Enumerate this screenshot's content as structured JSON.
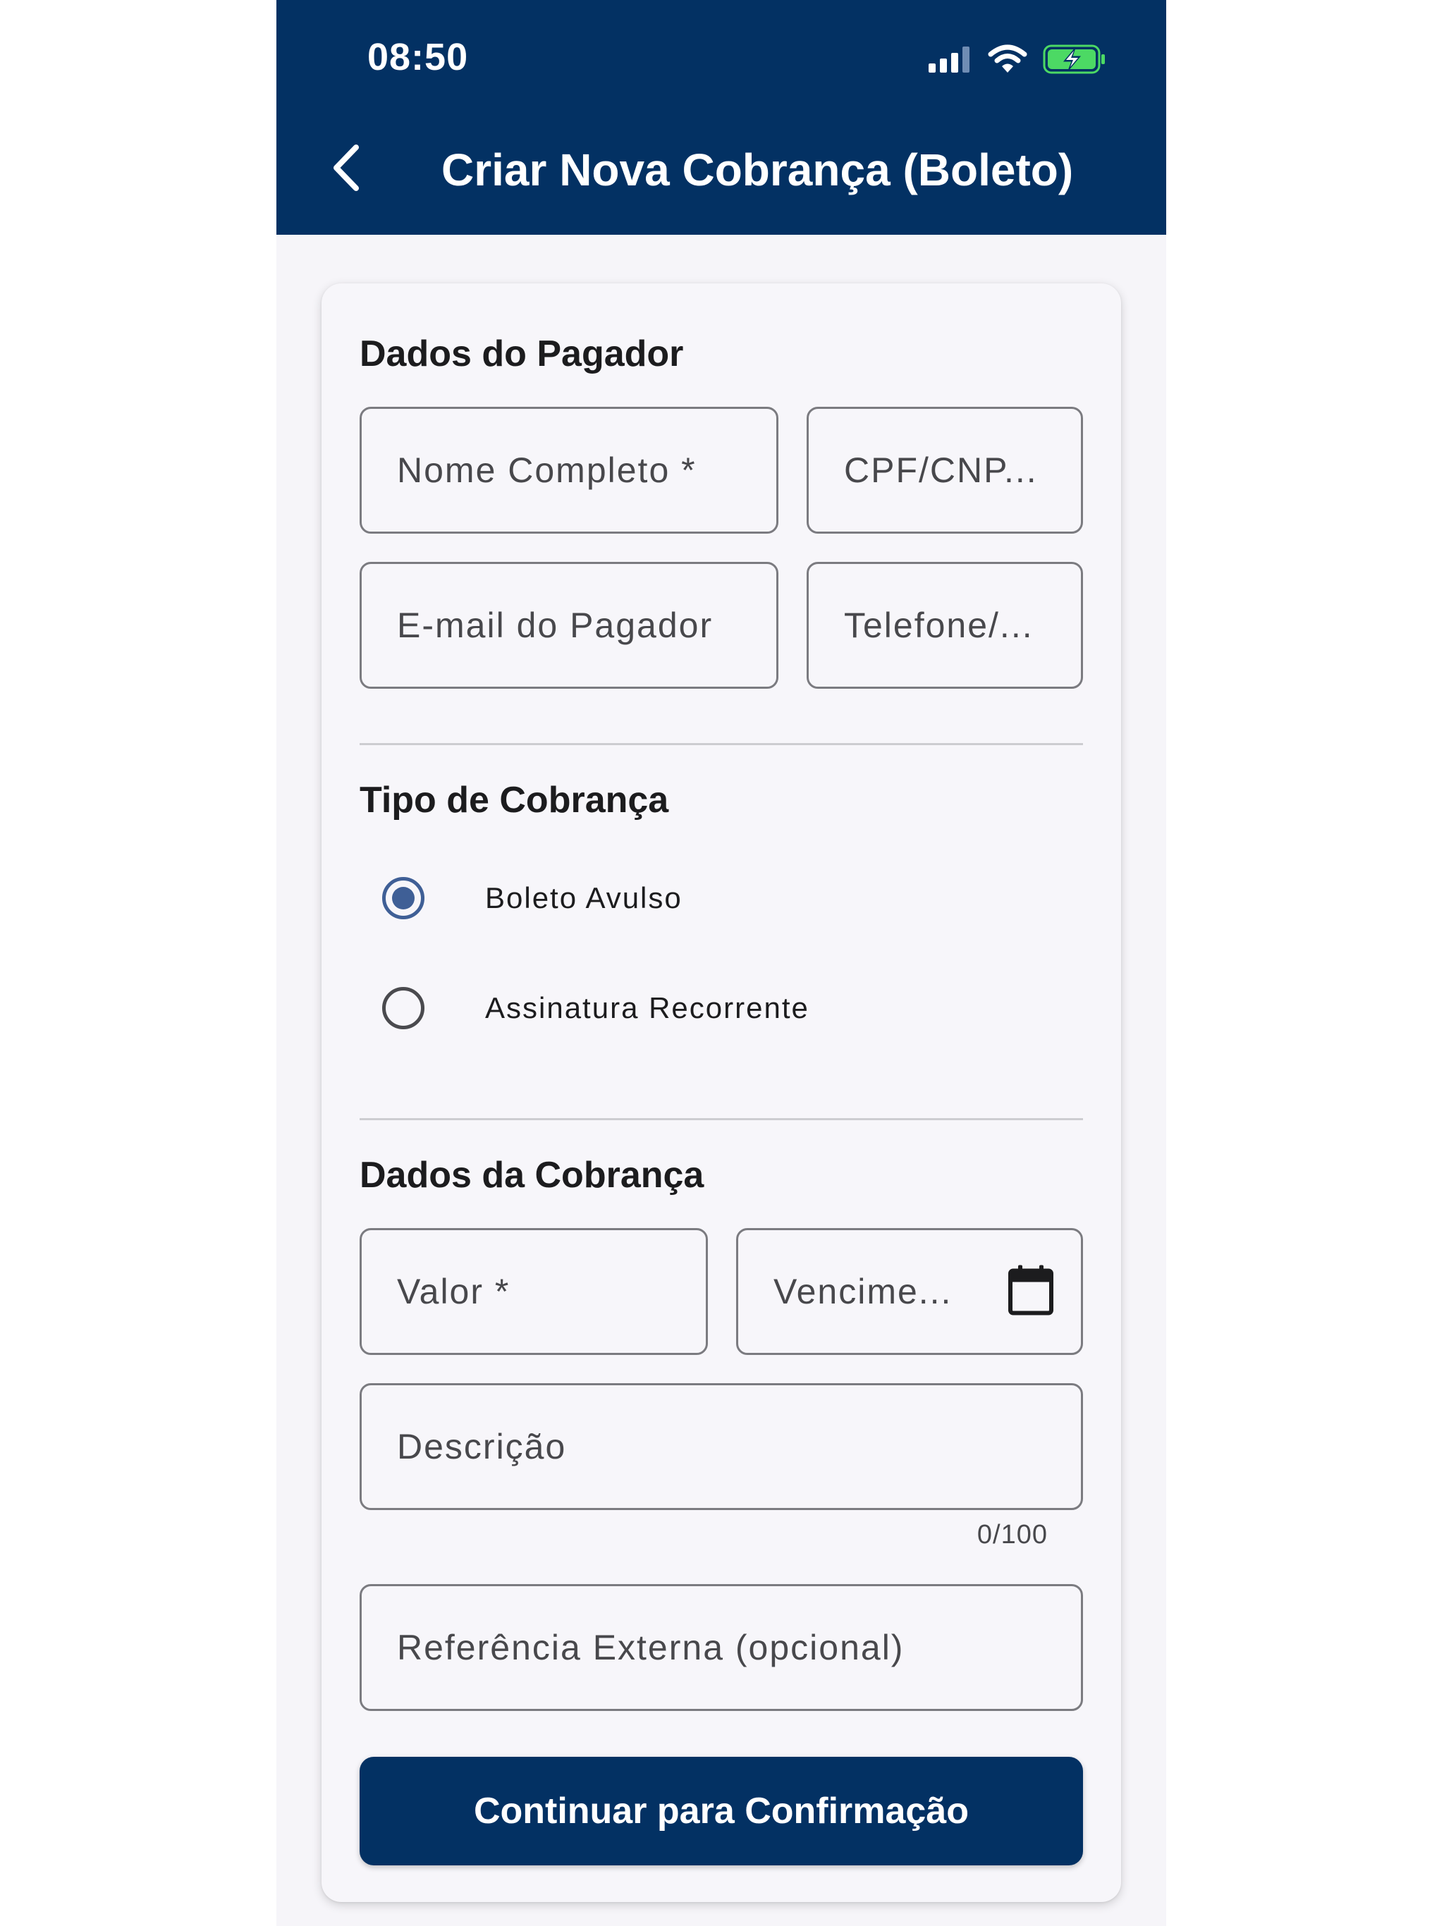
{
  "status_bar": {
    "time": "08:50"
  },
  "appbar": {
    "title": "Criar Nova Cobrança (Boleto)",
    "back_icon": "chevron-left-icon"
  },
  "payer_section": {
    "title": "Dados do Pagador",
    "full_name_placeholder": "Nome Completo *",
    "document_placeholder": "CPF/CNP...",
    "email_placeholder": "E-mail do Pagador",
    "phone_placeholder": "Telefone/..."
  },
  "charge_type_section": {
    "title": "Tipo de Cobrança",
    "options": [
      {
        "label": "Boleto Avulso",
        "selected": true
      },
      {
        "label": "Assinatura Recorrente",
        "selected": false
      }
    ]
  },
  "charge_data_section": {
    "title": "Dados da Cobrança",
    "value_placeholder": "Valor *",
    "due_date_placeholder": "Vencime...",
    "due_date_icon": "calendar-icon",
    "description_placeholder": "Descrição",
    "description_counter": "0/100",
    "external_ref_placeholder": "Referência Externa (opcional)"
  },
  "actions": {
    "continue_label": "Continuar para Confirmação"
  },
  "colors": {
    "primary": "#033163",
    "radio_accent": "#3f5f96",
    "battery_green": "#4cd964"
  }
}
